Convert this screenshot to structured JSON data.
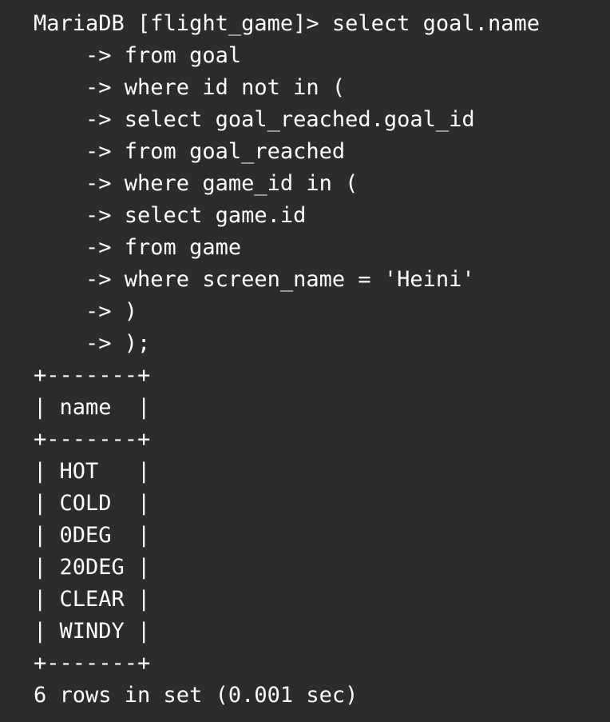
{
  "terminal": {
    "background": "#2b2c30",
    "foreground": "#ffffff",
    "lines": [
      "MariaDB [flight_game]> select goal.name",
      "    -> from goal",
      "    -> where id not in (",
      "    -> select goal_reached.goal_id",
      "    -> from goal_reached",
      "    -> where game_id in (",
      "    -> select game.id",
      "    -> from game",
      "    -> where screen_name = 'Heini'",
      "    -> )",
      "    -> );",
      "+-------+",
      "| name  |",
      "+-------+",
      "| HOT   |",
      "| COLD  |",
      "| 0DEG  |",
      "| 20DEG |",
      "| CLEAR |",
      "| WINDY |",
      "+-------+",
      "6 rows in set (0.001 sec)"
    ]
  }
}
